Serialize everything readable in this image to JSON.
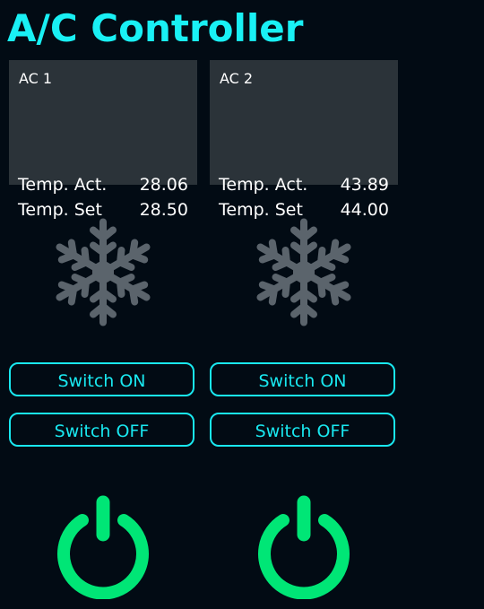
{
  "app": {
    "title": "A/C Controller"
  },
  "units": [
    {
      "name": "AC 1",
      "temp_act_label": "Temp. Act.",
      "temp_act_value": "28.06",
      "temp_set_label": "Temp. Set",
      "temp_set_value": "28.50",
      "mode_icon": "snowflake-icon",
      "switch_on_label": "Switch ON",
      "switch_off_label": "Switch OFF",
      "power_icon": "power-icon"
    },
    {
      "name": "AC 2",
      "temp_act_label": "Temp. Act.",
      "temp_act_value": "43.89",
      "temp_set_label": "Temp. Set",
      "temp_set_value": "44.00",
      "mode_icon": "snowflake-icon",
      "switch_on_label": "Switch ON",
      "switch_off_label": "Switch OFF",
      "power_icon": "power-icon"
    }
  ],
  "colors": {
    "background": "#020b14",
    "accent": "#19f0f4",
    "card": "#2b3339",
    "snowflake": "#5b646c",
    "power": "#00e676"
  }
}
